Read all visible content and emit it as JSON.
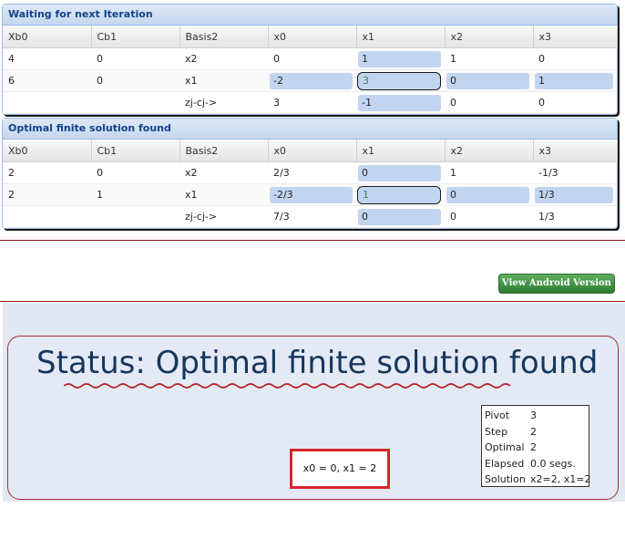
{
  "panel1": {
    "title": "Waiting for next Iteration",
    "columns": [
      "Xb0",
      "Cb1",
      "Basis2",
      "x0",
      "x1",
      "x2",
      "x3"
    ],
    "rows": [
      [
        "4",
        "0",
        "x2",
        "0",
        "1",
        "1",
        "0"
      ],
      [
        "6",
        "0",
        "x1",
        "-2",
        "3",
        "0",
        "1"
      ],
      [
        "",
        "",
        "zj-cj->",
        "3",
        "-1",
        "0",
        "0"
      ]
    ]
  },
  "panel2": {
    "title": "Optimal finite solution found",
    "columns": [
      "Xb0",
      "Cb1",
      "Basis2",
      "x0",
      "x1",
      "x2",
      "x3"
    ],
    "rows": [
      [
        "2",
        "0",
        "x2",
        "2/3",
        "0",
        "1",
        "-1/3"
      ],
      [
        "2",
        "1",
        "x1",
        "-2/3",
        "1",
        "0",
        "1/3"
      ],
      [
        "",
        "",
        "zj-cj->",
        "7/3",
        "0",
        "0",
        "1/3"
      ]
    ]
  },
  "android_button": "View Android Version",
  "status_title": "Status: Optimal finite solution found",
  "result": "x0 = 0, x1 = 2",
  "info": {
    "pivot_label": "Pivot",
    "pivot_value": "3",
    "step_label": "Step",
    "step_value": "2",
    "optimal_label": "Optimal",
    "optimal_value": "2",
    "elapsed_label": "Elapsed",
    "elapsed_value": "0.0 segs.",
    "solution_label": "Solution",
    "solution_value": "x2=2, x1=2"
  },
  "colors": {
    "accent": "#15428b",
    "highlight": "#c2d5f0",
    "result_border": "#d6262e",
    "button": "#2e7d32"
  }
}
